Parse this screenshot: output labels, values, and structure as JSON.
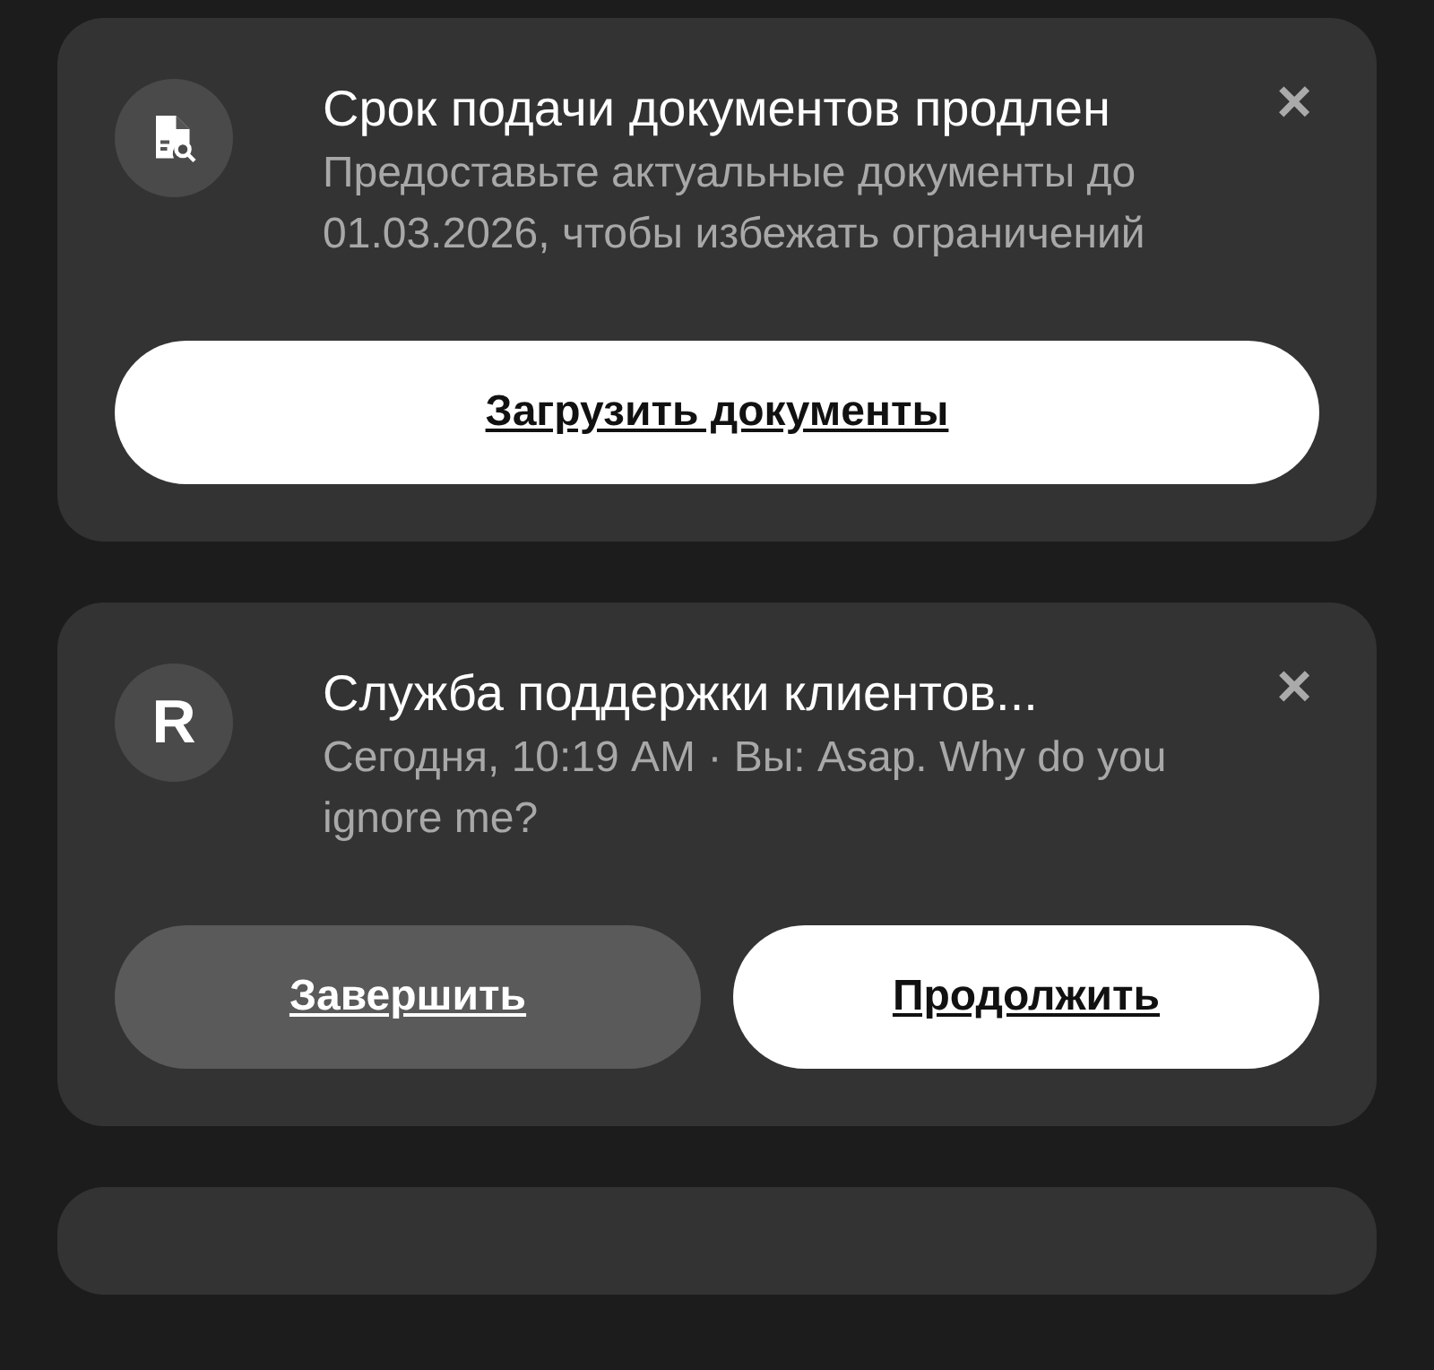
{
  "notifications": [
    {
      "icon": {
        "kind": "document"
      },
      "title": "Срок подачи документов продлен",
      "text": "Предоставьте актуальные документы до 01.03.2026, чтобы избежать ограничений",
      "close": "×",
      "actions": [
        {
          "label": "Загрузить документы",
          "kind": "primary"
        }
      ]
    },
    {
      "icon": {
        "kind": "logo",
        "text": "R"
      },
      "title": "Служба поддержки клиентов...",
      "text": "Сегодня, 10:19 AM · Вы: Asap. Why do you ignore me?",
      "close": "×",
      "actions": [
        {
          "label": "Завершить",
          "kind": "secondary"
        },
        {
          "label": "Продолжить",
          "kind": "primary"
        }
      ]
    }
  ]
}
